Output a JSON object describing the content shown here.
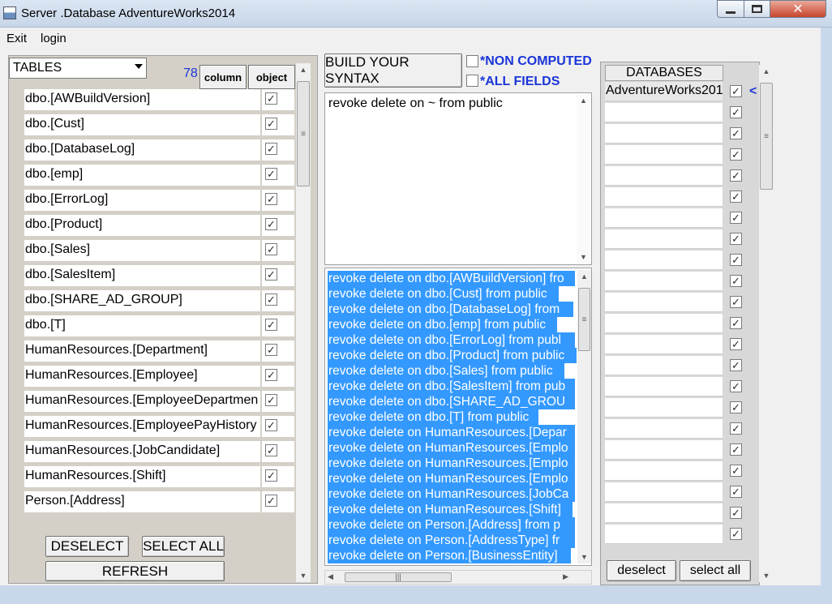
{
  "window": {
    "title": "Server                .Database AdventureWorks2014",
    "close_glyph": "✕"
  },
  "menu": [
    "Exit",
    "login"
  ],
  "left": {
    "dropdown_value": "TABLES",
    "count": "78",
    "column_button": "column",
    "object_button": "object",
    "tables": [
      "dbo.[AWBuildVersion]",
      "dbo.[Cust]",
      "dbo.[DatabaseLog]",
      "dbo.[emp]",
      "dbo.[ErrorLog]",
      "dbo.[Product]",
      "dbo.[Sales]",
      "dbo.[SalesItem]",
      "dbo.[SHARE_AD_GROUP]",
      "dbo.[T]",
      "HumanResources.[Department]",
      "HumanResources.[Employee]",
      "HumanResources.[EmployeeDepartmen",
      "HumanResources.[EmployeePayHistory",
      "HumanResources.[JobCandidate]",
      "HumanResources.[Shift]",
      "Person.[Address]"
    ],
    "check_glyph": "✓",
    "deselect_button": "DESELECT",
    "select_all_button": "SELECT ALL",
    "refresh_button": "REFRESH"
  },
  "middle": {
    "build_button": "BUILD YOUR SYNTAX",
    "non_computed_label": "*NON COMPUTED",
    "all_fields_label": "*ALL FIELDS",
    "syntax_template": "revoke delete on ~ from public",
    "results": [
      "revoke delete on dbo.[AWBuildVersion] fro",
      "revoke delete on dbo.[Cust] from public",
      "revoke delete on dbo.[DatabaseLog] from",
      "revoke delete on dbo.[emp] from public",
      "revoke delete on dbo.[ErrorLog] from publ",
      "revoke delete on dbo.[Product] from public",
      "revoke delete on dbo.[Sales] from public",
      "revoke delete on dbo.[SalesItem] from pub",
      "revoke delete on dbo.[SHARE_AD_GROU",
      "revoke delete on dbo.[T] from public",
      "revoke delete on HumanResources.[Depar",
      "revoke delete on HumanResources.[Emplo",
      "revoke delete on HumanResources.[Emplo",
      "revoke delete on HumanResources.[Emplo",
      "revoke delete on HumanResources.[JobCa",
      "revoke delete on HumanResources.[Shift]",
      "revoke delete on Person.[Address] from p",
      "revoke delete on Person.[AddressType] fr",
      "revoke delete on Person.[BusinessEntity]"
    ]
  },
  "right": {
    "header": "DATABASES",
    "first_db": "AdventureWorks201",
    "marker": "<",
    "deselect_button": "deselect",
    "select_all_button": "select all"
  },
  "scroll": {
    "up": "▲",
    "down": "▼",
    "left": "◀",
    "right": "▶",
    "grip": "≡",
    "hgrip": "|||"
  }
}
